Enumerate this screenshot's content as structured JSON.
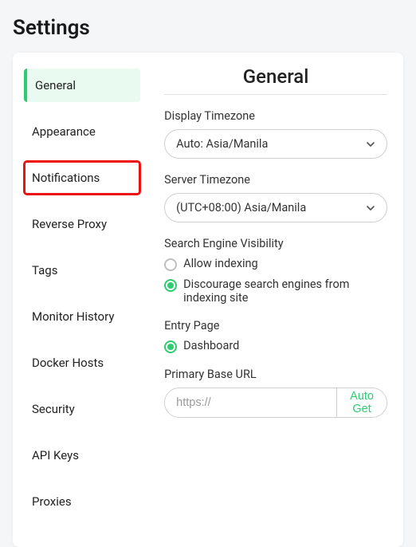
{
  "page_title": "Settings",
  "sidebar": {
    "items": [
      {
        "label": "General"
      },
      {
        "label": "Appearance"
      },
      {
        "label": "Notifications"
      },
      {
        "label": "Reverse Proxy"
      },
      {
        "label": "Tags"
      },
      {
        "label": "Monitor History"
      },
      {
        "label": "Docker Hosts"
      },
      {
        "label": "Security"
      },
      {
        "label": "API Keys"
      },
      {
        "label": "Proxies"
      }
    ]
  },
  "main": {
    "title": "General",
    "display_timezone": {
      "label": "Display Timezone",
      "value": "Auto: Asia/Manila"
    },
    "server_timezone": {
      "label": "Server Timezone",
      "value": "(UTC+08:00) Asia/Manila"
    },
    "search_visibility": {
      "label": "Search Engine Visibility",
      "allow": "Allow indexing",
      "discourage": "Discourage search engines from indexing site"
    },
    "entry_page": {
      "label": "Entry Page",
      "option": "Dashboard"
    },
    "primary_base_url": {
      "label": "Primary Base URL",
      "placeholder": "https://",
      "auto_get": "Auto Get"
    }
  }
}
